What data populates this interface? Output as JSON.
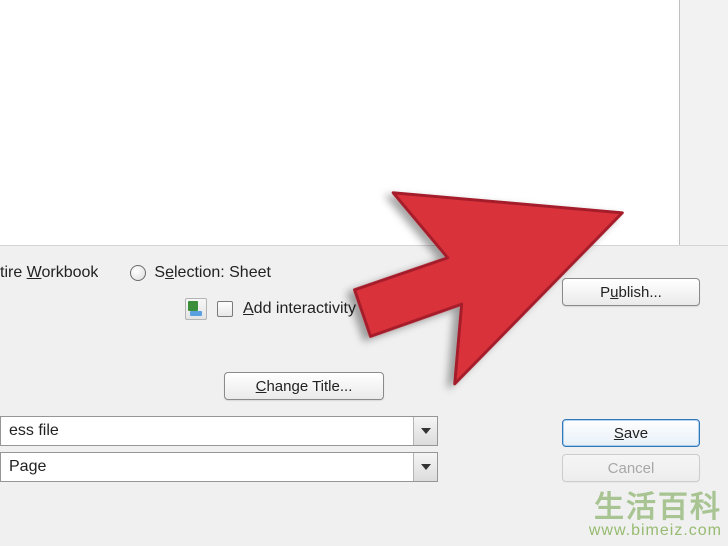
{
  "row1": {
    "workbook_label_prefix": "tire ",
    "workbook_label_key": "W",
    "workbook_label_rest": "orkbook",
    "selection_label_prefix": "S",
    "selection_label_key": "e",
    "selection_label_rest": "lection: Sheet",
    "publish_prefix": "P",
    "publish_key": "u",
    "publish_rest": "blish..."
  },
  "row2": {
    "add_prefix": "",
    "add_key": "A",
    "add_rest": "dd interactivity"
  },
  "change_title": {
    "prefix": "",
    "key": "C",
    "rest": "hange Title..."
  },
  "combos": {
    "file_text": "ess file",
    "page_text": "Page"
  },
  "buttons": {
    "save_key": "S",
    "save_rest": "ave",
    "cancel": "Cancel"
  },
  "watermark": {
    "top": "生活百科",
    "bottom": "www.bimeiz.com"
  }
}
